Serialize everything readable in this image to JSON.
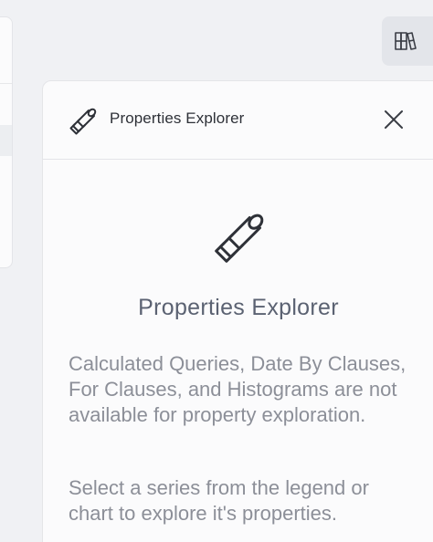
{
  "toolbar": {
    "panel_toggle_icon": "books-icon"
  },
  "panel": {
    "header_title": "Properties Explorer",
    "header_icon": "telescope-icon",
    "close_icon": "close-icon"
  },
  "empty_state": {
    "icon": "telescope-icon",
    "title": "Properties Explorer",
    "message_1": "Calculated Queries, Date By Clauses, For Clauses, and Histograms are not available for property exploration.",
    "message_2": "Select a series from the legend or chart to explore it's properties."
  },
  "colors": {
    "background": "#f0f1f4",
    "panel": "#fbfbfc",
    "title_text": "#5b6272",
    "body_text": "#8c8f98",
    "icon_stroke": "#2e3138"
  }
}
